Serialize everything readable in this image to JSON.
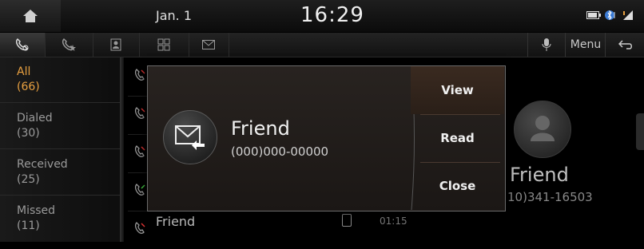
{
  "status_bar": {
    "date": "Jan. 1",
    "time": "16:29"
  },
  "tabs": [
    {
      "icon": "call-history-icon",
      "active": true
    },
    {
      "icon": "favorite-call-icon",
      "active": false
    },
    {
      "icon": "contacts-icon",
      "active": false
    },
    {
      "icon": "keypad-icon",
      "active": false
    },
    {
      "icon": "message-icon",
      "active": false
    }
  ],
  "toolbar": {
    "menu_label": "Menu"
  },
  "categories": [
    {
      "label": "All",
      "count": "(66)",
      "active": true
    },
    {
      "label": "Dialed",
      "count": "(30)",
      "active": false
    },
    {
      "label": "Received",
      "count": "(25)",
      "active": false
    },
    {
      "label": "Missed",
      "count": "(11)",
      "active": false
    }
  ],
  "list": {
    "last_row_name": "Friend",
    "last_row_time": "01:15"
  },
  "detail": {
    "name": "Friend",
    "number": "10)341-16503"
  },
  "popup": {
    "title": "Friend",
    "number": "(000)000-00000",
    "actions": {
      "view": "View",
      "read": "Read",
      "close": "Close"
    }
  },
  "colors": {
    "accent": "#e8a040"
  }
}
